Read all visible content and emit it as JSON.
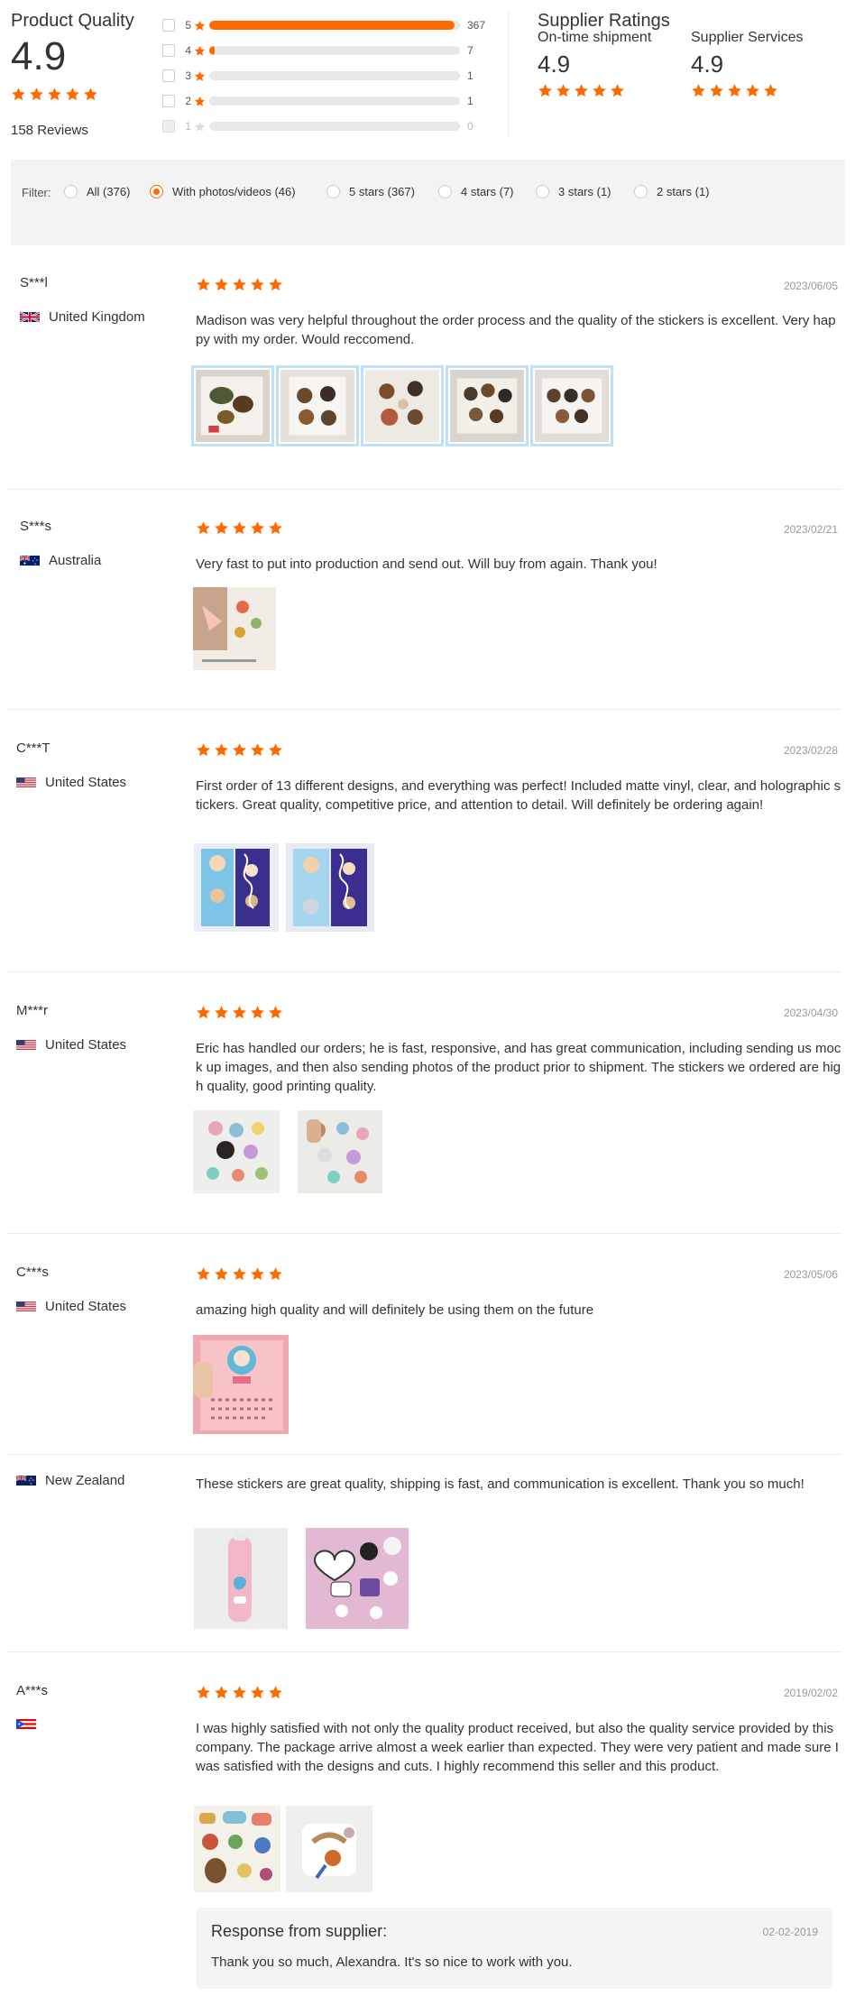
{
  "summary": {
    "product_quality_title": "Product Quality",
    "product_quality_score": "4.9",
    "reviews_count": "158 Reviews",
    "distribution": [
      {
        "stars": "5",
        "count": "367",
        "fraction": 0.98,
        "disabled": false
      },
      {
        "stars": "4",
        "count": "7",
        "fraction": 0.02,
        "disabled": false
      },
      {
        "stars": "3",
        "count": "1",
        "fraction": 0,
        "disabled": false
      },
      {
        "stars": "2",
        "count": "1",
        "fraction": 0,
        "disabled": false
      },
      {
        "stars": "1",
        "count": "0",
        "fraction": 0,
        "disabled": true
      }
    ],
    "supplier_ratings_title": "Supplier Ratings",
    "on_time_label": "On-time shipment",
    "on_time_score": "4.9",
    "services_label": "Supplier Services",
    "services_score": "4.9"
  },
  "filter": {
    "label": "Filter:",
    "options": [
      {
        "label": "All (376)",
        "selected": false
      },
      {
        "label": "With photos/videos (46)",
        "selected": true
      },
      {
        "label": "5 stars (367)",
        "selected": false
      },
      {
        "label": "4 stars (7)",
        "selected": false
      },
      {
        "label": "3 stars (1)",
        "selected": false
      },
      {
        "label": "2 stars (1)",
        "selected": false
      }
    ]
  },
  "reviews": [
    {
      "name": "S***l",
      "country": "United Kingdom",
      "flag": "uk-flag",
      "date": "2023/06/05",
      "rating": 5,
      "text": "Madison was very helpful throughout the order process and the quality of the stickers is excellent. Very happy with my order. Would reccomend."
    },
    {
      "name": "S***s",
      "country": "Australia",
      "flag": "australia-flag",
      "date": "2023/02/21",
      "rating": 5,
      "text": "Very fast to put into production and send out. Will buy from again. Thank you!"
    },
    {
      "name": "C***T",
      "country": "United States",
      "flag": "us-flag",
      "date": "2023/02/28",
      "rating": 5,
      "text": "First order of 13 different designs, and everything was perfect! Included matte vinyl, clear, and holographic stickers. Great quality, competitive price, and attention to detail. Will definitely be ordering again!"
    },
    {
      "name": "M***r",
      "country": "United States",
      "flag": "us-flag",
      "date": "2023/04/30",
      "rating": 5,
      "text": "Eric has handled our orders; he is fast, responsive, and has great communication, including sending us mock up images, and then also sending photos of the product prior to shipment. The stickers we ordered are high quality, good printing quality."
    },
    {
      "name": "C***s",
      "country": "United States",
      "flag": "us-flag",
      "date": "2023/05/06",
      "rating": 5,
      "text": "amazing high quality and will definitely be using them on the future"
    },
    {
      "name": "",
      "country": "New Zealand",
      "flag": "nz-flag",
      "date": "",
      "rating": 0,
      "text": "These stickers are great quality, shipping is fast, and communication is excellent. Thank you so much!"
    },
    {
      "name": "A***s",
      "country": "",
      "flag": "puerto-rico-flag",
      "date": "2019/02/02",
      "rating": 5,
      "text": "I was highly satisfied with not only the quality product received, but also the quality service provided by this company. The package arrive almost a week earlier than expected. They were very patient and made sure I was satisfied with the designs and cuts. I highly recommend this seller and this product."
    }
  ],
  "response": {
    "title": "Response from supplier:",
    "date": "02-02-2019",
    "text": "Thank you so much, Alexandra. It's so nice to work with you."
  },
  "colors": {
    "accent": "#ff6a00",
    "star": "#ff6a00",
    "bar_track": "#e8e8e8",
    "filter_bg": "#f3f3f3"
  }
}
